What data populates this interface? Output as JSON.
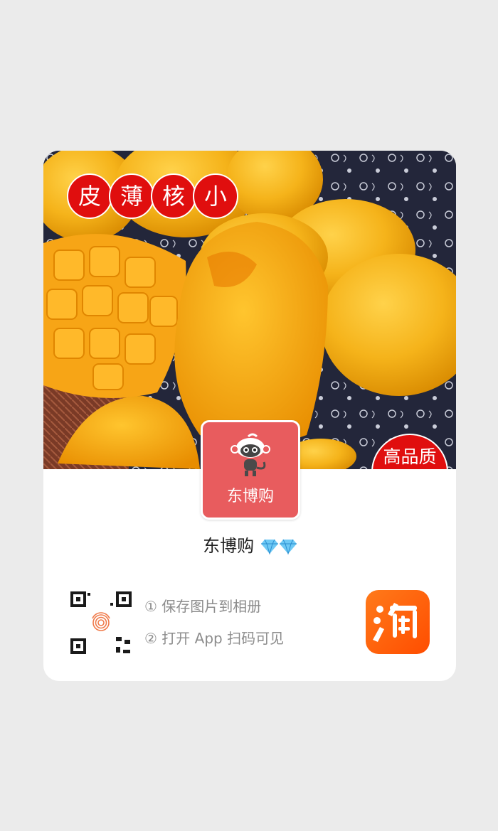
{
  "banner": {
    "tags": [
      "皮",
      "薄",
      "核",
      "小"
    ],
    "quality_badge": "高品质"
  },
  "shop": {
    "avatar_label": "东博购",
    "name": "东博购"
  },
  "instructions": {
    "step1": "① 保存图片到相册",
    "step2": "② 打开 App 扫码可见"
  },
  "icons": {
    "brand_app": "taobao-icon",
    "qr": "qr-code-icon",
    "fingerprint": "fingerprint-icon",
    "gems": "diamond-icon"
  },
  "colors": {
    "badge_red": "#e00e0e",
    "avatar_bg": "#e85c5e",
    "taobao_orange": "#ff5a0a"
  }
}
